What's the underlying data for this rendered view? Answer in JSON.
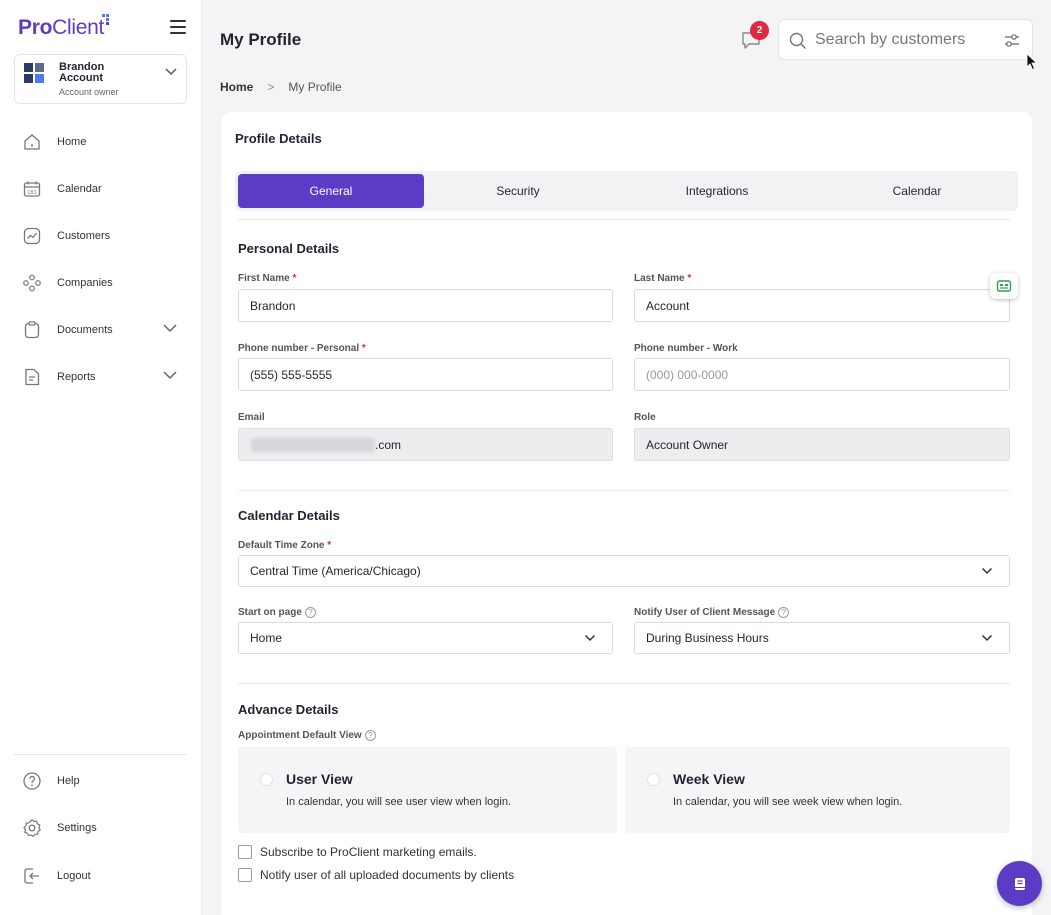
{
  "brand": {
    "name_pro": "Pro",
    "name_client": "Client",
    "accent": "#5b3cc4"
  },
  "account": {
    "name": "Brandon Account",
    "role": "Account owner"
  },
  "nav": [
    {
      "label": "Home",
      "icon": "home-icon"
    },
    {
      "label": "Calendar",
      "icon": "calendar-icon"
    },
    {
      "label": "Customers",
      "icon": "customers-icon"
    },
    {
      "label": "Companies",
      "icon": "companies-icon"
    },
    {
      "label": "Documents",
      "icon": "documents-icon",
      "expandable": true
    },
    {
      "label": "Reports",
      "icon": "reports-icon",
      "expandable": true
    }
  ],
  "bottom_nav": [
    {
      "label": "Help",
      "icon": "help-icon"
    },
    {
      "label": "Settings",
      "icon": "settings-icon"
    },
    {
      "label": "Logout",
      "icon": "logout-icon"
    }
  ],
  "header": {
    "title": "My Profile",
    "notification_count": "2",
    "search_placeholder": "Search by customers"
  },
  "breadcrumb": {
    "home": "Home",
    "separator": ">",
    "current": "My Profile"
  },
  "profile": {
    "title": "Profile Details",
    "tabs": [
      {
        "label": "General",
        "active": true
      },
      {
        "label": "Security",
        "active": false
      },
      {
        "label": "Integrations",
        "active": false
      },
      {
        "label": "Calendar",
        "active": false
      }
    ],
    "personal": {
      "title": "Personal Details",
      "first_name_label": "First Name",
      "first_name_value": "Brandon",
      "last_name_label": "Last Name",
      "last_name_value": "Account",
      "phone_personal_label": "Phone number - Personal",
      "phone_personal_value": "(555) 555-5555",
      "phone_work_label": "Phone number - Work",
      "phone_work_placeholder": "(000) 000-0000",
      "email_label": "Email",
      "email_suffix": ".com",
      "role_label": "Role",
      "role_value": "Account Owner",
      "required_mark": "*"
    },
    "calendar": {
      "title": "Calendar Details",
      "timezone_label": "Default Time Zone",
      "timezone_value": "Central Time (America/Chicago)",
      "start_page_label": "Start on page",
      "start_page_value": "Home",
      "notify_label": "Notify User of Client Message",
      "notify_value": "During Business Hours",
      "help_mark": "?"
    },
    "advance": {
      "title": "Advance Details",
      "view_label": "Appointment Default View",
      "options": [
        {
          "title": "User View",
          "desc": "In calendar, you will see user view when login."
        },
        {
          "title": "Week View",
          "desc": "In calendar, you will see week view when login."
        }
      ],
      "checkbox_marketing": "Subscribe to ProClient marketing emails.",
      "checkbox_documents": "Notify user of all uploaded documents by clients"
    }
  }
}
